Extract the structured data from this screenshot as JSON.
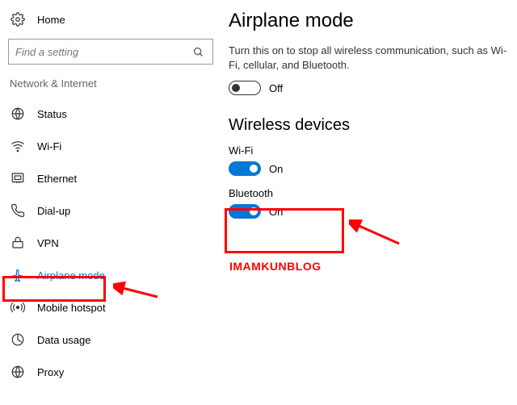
{
  "sidebar": {
    "home": "Home",
    "search_placeholder": "Find a setting",
    "section": "Network & Internet",
    "items": [
      {
        "label": "Status"
      },
      {
        "label": "Wi-Fi"
      },
      {
        "label": "Ethernet"
      },
      {
        "label": "Dial-up"
      },
      {
        "label": "VPN"
      },
      {
        "label": "Airplane mode"
      },
      {
        "label": "Mobile hotspot"
      },
      {
        "label": "Data usage"
      },
      {
        "label": "Proxy"
      }
    ]
  },
  "main": {
    "title": "Airplane mode",
    "description": "Turn this on to stop all wireless communication, such as Wi-Fi, cellular, and Bluetooth.",
    "airplane_state": "Off",
    "section2": "Wireless devices",
    "wifi": {
      "name": "Wi-Fi",
      "state": "On"
    },
    "bluetooth": {
      "name": "Bluetooth",
      "state": "On"
    }
  },
  "annotation": {
    "watermark": "IMAMKUNBLOG"
  }
}
